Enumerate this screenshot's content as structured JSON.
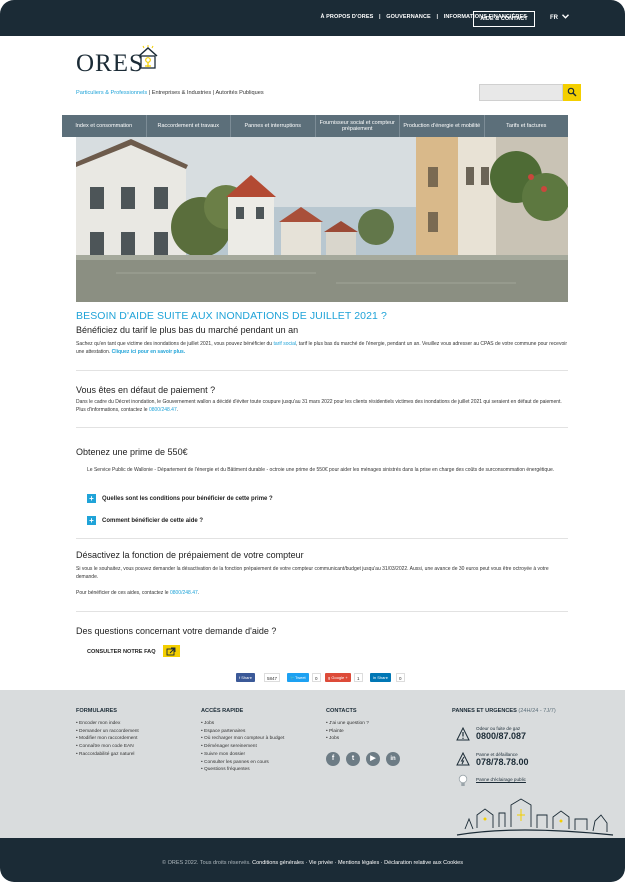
{
  "topbar": {
    "links": [
      "À PROPOS D'ORES",
      "GOUVERNANCE",
      "INFORMATIONS FINANCIÈRES"
    ],
    "separator": "|",
    "aide_contact": "AIDE & CONTACT",
    "lang": "FR"
  },
  "brand": {
    "logo": "ORES"
  },
  "audience": {
    "items": [
      "Particuliers & Professionnels",
      "Entreprises & Industries",
      "Autorités Publiques"
    ],
    "separator": "|"
  },
  "nav": {
    "items": [
      "Index et consommation",
      "Raccordement et travaux",
      "Pannes et interruptions",
      "Fournisseur social et compteur prépaiement",
      "Production d'énergie et mobilité",
      "Tarifs et factures"
    ]
  },
  "article": {
    "title": "BESOIN D'AIDE SUITE AUX INONDATIONS DE JUILLET 2021 ?",
    "subtitle": "Bénéficiez du tarif le plus bas du marché pendant un an",
    "intro_1": "Sachez qu'en tant que victime des inondations de juillet 2021, vous pouvez bénéficier du ",
    "intro_link": "tarif social",
    "intro_2": ", tarif le plus bas du marché de l'énergie, pendant un an. Veuillez vous adresser au CPAS de votre commune pour recevoir une attestation. ",
    "intro_cta": "Cliquez ici pour en savoir plus.",
    "s1_title": "Vous êtes en défaut de paiement ?",
    "s1_text": "Dans le cadre du Décret inondation, le Gouvernement wallon a décidé d'éviter toute coupure jusqu'au 31 mars 2022 pour les clients résidentiels victimes des inondations de juillet 2021 qui seraient en défaut de paiement. Plus d'informations, contactez le ",
    "s1_phone": "0800/248.47",
    "s1_end": ".",
    "s2_title": "Obtenez une prime de 550€",
    "s2_text": "Le Service Public de Wallonie - Département de l'énergie et du Bâtiment durable - octroie une prime de 550€ pour aider les ménages sinistrés dans la prise en charge des coûts de surconsommation énergétique.",
    "acc_1": "Quelles sont les conditions pour bénéficier de cette prime ?",
    "acc_2": "Comment bénéficier de cette aide ?",
    "s3_title": "Désactivez la fonction de prépaiement de votre compteur",
    "s3_text": "Si vous le souhaitez, vous pouvez demander la désactivation de la fonction prépaiement de votre compteur communicant/budget jusqu'au 31/03/2022. Aussi, une avance de 30 euros peut vous être octroyée à votre demande.",
    "s3_text2": "Pour bénéficier de ces aides, contactez le ",
    "s3_phone": "0800/248.47",
    "s3_end": ".",
    "s4_title": "Des questions concernant votre demande d'aide ?",
    "faq": "CONSULTER NOTRE FAQ"
  },
  "share": {
    "facebook": "Share",
    "facebook_count": "5847",
    "twitter": "Tweet",
    "twitter_count": "0",
    "google": "Google +",
    "google_count": "1",
    "linkedin": "Share",
    "linkedin_count": "0"
  },
  "footer": {
    "formulaires": {
      "title": "FORMULAIRES",
      "items": [
        "Encoder mon index",
        "Demander un raccordement",
        "Modifier mon raccordement",
        "Connaître mon code EAN",
        "Raccordabilité gaz naturel"
      ]
    },
    "acces": {
      "title": "ACCÈS RAPIDE",
      "items": [
        "Jobs",
        "Espace partenaires",
        "Où recharger mon compteur à budget",
        "Déménager sereinement",
        "Suivre mon dossier",
        "Consulter les pannes en cours",
        "Questions fréquentes"
      ]
    },
    "contacts": {
      "title": "CONTACTS",
      "items": [
        "J'ai une question ?",
        "Plainte",
        "Jobs"
      ]
    },
    "urgences": {
      "title": "PANNES ET URGENCES",
      "hours": "(24H/24 - 7J/7)",
      "gas_label": "Odeur ou fuite de gaz",
      "gas_phone": "0800/87.087",
      "elec_label": "Panne et défaillance",
      "elec_phone": "078/78.78.00",
      "light_label": "Panne d'éclairage public"
    },
    "copyright": "© ORES 2022. Tous droits réservés.",
    "legal": "Conditions générales · Vie privée · Mentions légales · Déclaration relative aux Cookies"
  },
  "colors": {
    "accent": "#1fa3d8",
    "dark": "#1b2b36",
    "nav": "#5c6f7a",
    "yellow": "#f4cf00",
    "footer": "#d9dcdd"
  }
}
